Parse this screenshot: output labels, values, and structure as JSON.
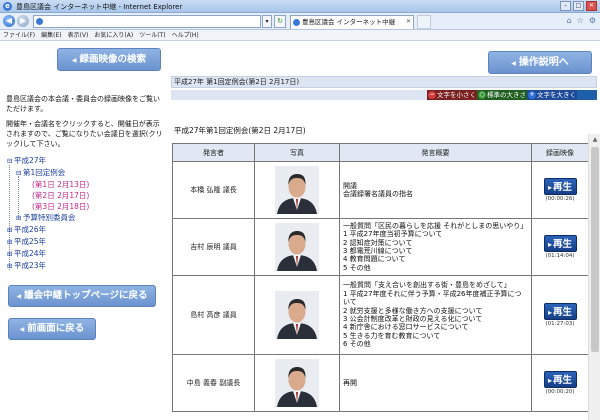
{
  "browser": {
    "window_title": "豊島区議会 インターネット中継 - Internet Explorer",
    "url": "",
    "tab_title": "豊島区議会 インターネット中継",
    "menu": [
      "ファイル(F)",
      "編集(E)",
      "表示(V)",
      "お気に入り(A)",
      "ツール(T)",
      "ヘルプ(H)"
    ]
  },
  "sidebar": {
    "archive_button": "録画映像の検索",
    "intro": "豊島区議会の本会議・委員会の録画映像をご覧いただけます。",
    "instruction": "開催年・会議名をクリックすると、開催日が表示されますので、ご覧になりたい会議日を選択(クリック)して下さい。",
    "tree": [
      {
        "label": "平成27年",
        "toggle": "⊟",
        "level": 0
      },
      {
        "label": "第1回定例会",
        "toggle": "⊟",
        "level": 1
      },
      {
        "label": "(第1日 2月13日)",
        "toggle": "",
        "level": 2
      },
      {
        "label": "(第2日 2月17日)",
        "toggle": "",
        "level": 2
      },
      {
        "label": "(第3日 2月18日)",
        "toggle": "",
        "level": 2
      },
      {
        "label": "予算特別委員会",
        "toggle": "⊞",
        "level": 1
      },
      {
        "label": "平成26年",
        "toggle": "⊞",
        "level": 0
      },
      {
        "label": "平成25年",
        "toggle": "⊞",
        "level": 0
      },
      {
        "label": "平成24年",
        "toggle": "⊞",
        "level": 0
      },
      {
        "label": "平成23年",
        "toggle": "⊞",
        "level": 0
      }
    ],
    "live_top_button": "議会中継トップページに戻る",
    "previous_page_button": "前画面に戻る"
  },
  "main": {
    "operation_guide_button": "操作説明へ",
    "session_header": "平成27年 第1回定例会(第2日 2月17日)",
    "font_controls": {
      "small": "文字を小さく",
      "normal": "標準の大きさ",
      "large": "文字を大きく"
    },
    "agenda_title": "平成27年第1回定例会(第2日 2月17日)",
    "table_headers": {
      "speaker": "発言者",
      "photo": "写真",
      "summary": "発言概要",
      "video": "録画映像"
    },
    "play_label": "再生",
    "rows": [
      {
        "speaker": "本橋 弘隆 議長",
        "summary": [
          "開議",
          "会議録署名議員の指名"
        ],
        "duration": "(00:00:26)"
      },
      {
        "speaker": "吉村 辰明 議員",
        "summary": [
          "一般質問「区民の暮らしを応援 それがとしまの思いやり」",
          "1 平成27年度当初予算について",
          "2 認知症対策について",
          "3 都電荒川線について",
          "4 教育問題について",
          "5 その他"
        ],
        "duration": "(01:14:04)"
      },
      {
        "speaker": "島村 高彦 議員",
        "summary": [
          "一般質問「支え合いを創出する街・豊島をめざして」",
          "1 平成27年度それに伴う予算・平成26年度補正予算について",
          "2 就労支援と多様な働き方への支援について",
          "3 公会計制度改革と財政の見える化について",
          "4 新庁舎における窓口サービスについて",
          "5 生きる力を育む教育について",
          "6 その他"
        ],
        "duration": "(01:27:03)"
      },
      {
        "speaker": "中島 義春 副議長",
        "summary": [
          "再開"
        ],
        "duration": "(00:00:20)"
      }
    ]
  }
}
